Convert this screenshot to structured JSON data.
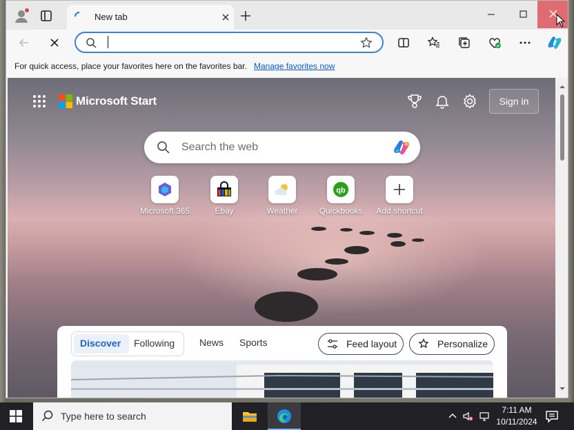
{
  "window": {
    "tab_title": "New tab"
  },
  "addressbar": {
    "value": ""
  },
  "favorites_bar": {
    "message": "For quick access, place your favorites here on the favorites bar.",
    "link": "Manage favorites now"
  },
  "page": {
    "brand": "Microsoft Start",
    "sign_in": "Sign in",
    "search_placeholder": "Search the web",
    "shortcuts": [
      {
        "label": "Microsoft 365",
        "icon": "microsoft-365-icon"
      },
      {
        "label": "Ebay",
        "icon": "ebay-icon"
      },
      {
        "label": "Weather",
        "icon": "weather-icon"
      },
      {
        "label": "Quickbooks",
        "icon": "quickbooks-icon"
      },
      {
        "label": "Add shortcut",
        "icon": "plus-icon"
      }
    ],
    "feed": {
      "pill_tabs": [
        "Discover",
        "Following"
      ],
      "active_tab": "Discover",
      "tabs": [
        "News",
        "Sports"
      ],
      "feed_layout": "Feed layout",
      "personalize": "Personalize"
    }
  },
  "taskbar": {
    "search_placeholder": "Type here to search",
    "time": "7:11 AM",
    "date": "10/11/2024"
  },
  "colors": {
    "accent": "#1f64c8",
    "address_focus": "#3c7fd6",
    "close_hover": "#e06c73",
    "taskbar": "#202025"
  }
}
